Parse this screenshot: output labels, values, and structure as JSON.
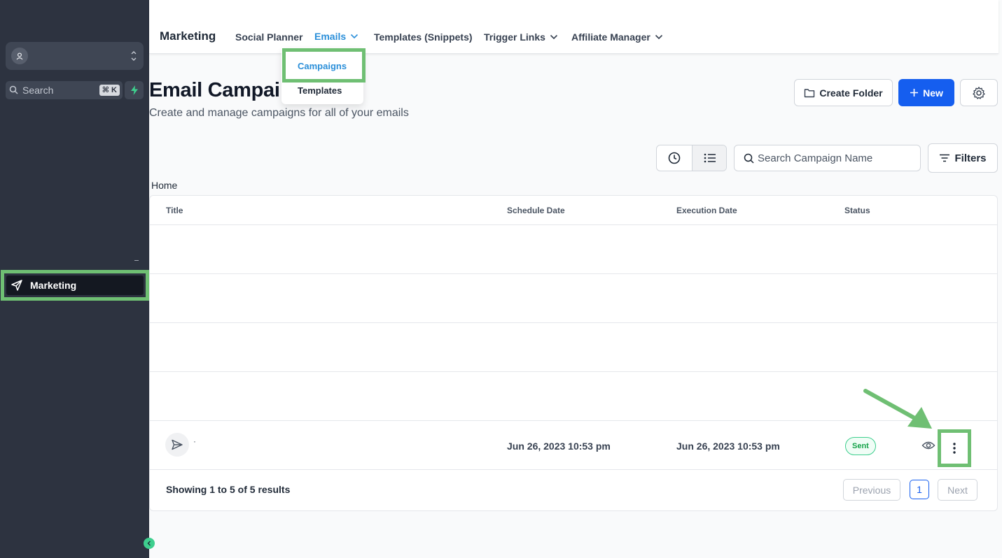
{
  "sidebar": {
    "search_label": "Search",
    "search_shortcut": "⌘ K",
    "nav_item_label": "Marketing"
  },
  "topbar": {
    "brand": "Marketing",
    "nav": {
      "social_planner": "Social Planner",
      "emails": "Emails",
      "templates_snippets": "Templates (Snippets)",
      "trigger_links": "Trigger Links",
      "affiliate_manager": "Affiliate Manager"
    }
  },
  "dropdown": {
    "campaigns": "Campaigns",
    "templates": "Templates"
  },
  "page": {
    "title": "Email Campai",
    "subtitle": "Create and manage campaigns for all of your emails",
    "create_folder": "Create Folder",
    "new": "New",
    "search_placeholder": "Search Campaign Name",
    "filters": "Filters",
    "breadcrumb": "Home"
  },
  "table": {
    "columns": {
      "title": "Title",
      "schedule_date": "Schedule Date",
      "execution_date": "Execution Date",
      "status": "Status"
    },
    "rows": [
      {
        "title": "·",
        "schedule_date": "Jun 26, 2023 10:53 pm",
        "execution_date": "Jun 26, 2023 10:53 pm",
        "status": "Sent"
      }
    ],
    "footer": "Showing 1 to 5 of 5 results",
    "pagination": {
      "previous": "Previous",
      "current": "1",
      "next": "Next"
    }
  },
  "colors": {
    "highlight": "#6fbf73",
    "primary": "#155eef",
    "active_nav": "#2b8fd9",
    "sidebar_bg": "#2d3340"
  }
}
